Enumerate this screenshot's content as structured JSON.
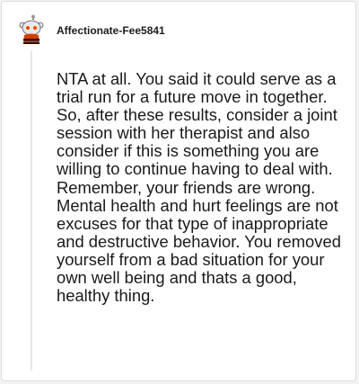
{
  "comment": {
    "author": "Affectionate-Fee5841",
    "body": "NTA at all. You said it could serve as a trial run for a future move in together. So, after these results, consider a joint session with her therapist and also consider if this is something you are willing to continue having to deal with. Remember, your friends are wrong. Mental health and hurt feelings are not excuses for that type of inappropriate and destructive behavior. You removed yourself from a bad situation for your own well being and thats a good, healthy thing."
  },
  "colors": {
    "avatar_head": "#e8e8e8",
    "avatar_body": "#d93a00",
    "avatar_stripe": "#1a1a1b",
    "thread_line": "#e6e6e6"
  },
  "icons": {
    "avatar": "reddit-snoo-avatar-icon"
  }
}
